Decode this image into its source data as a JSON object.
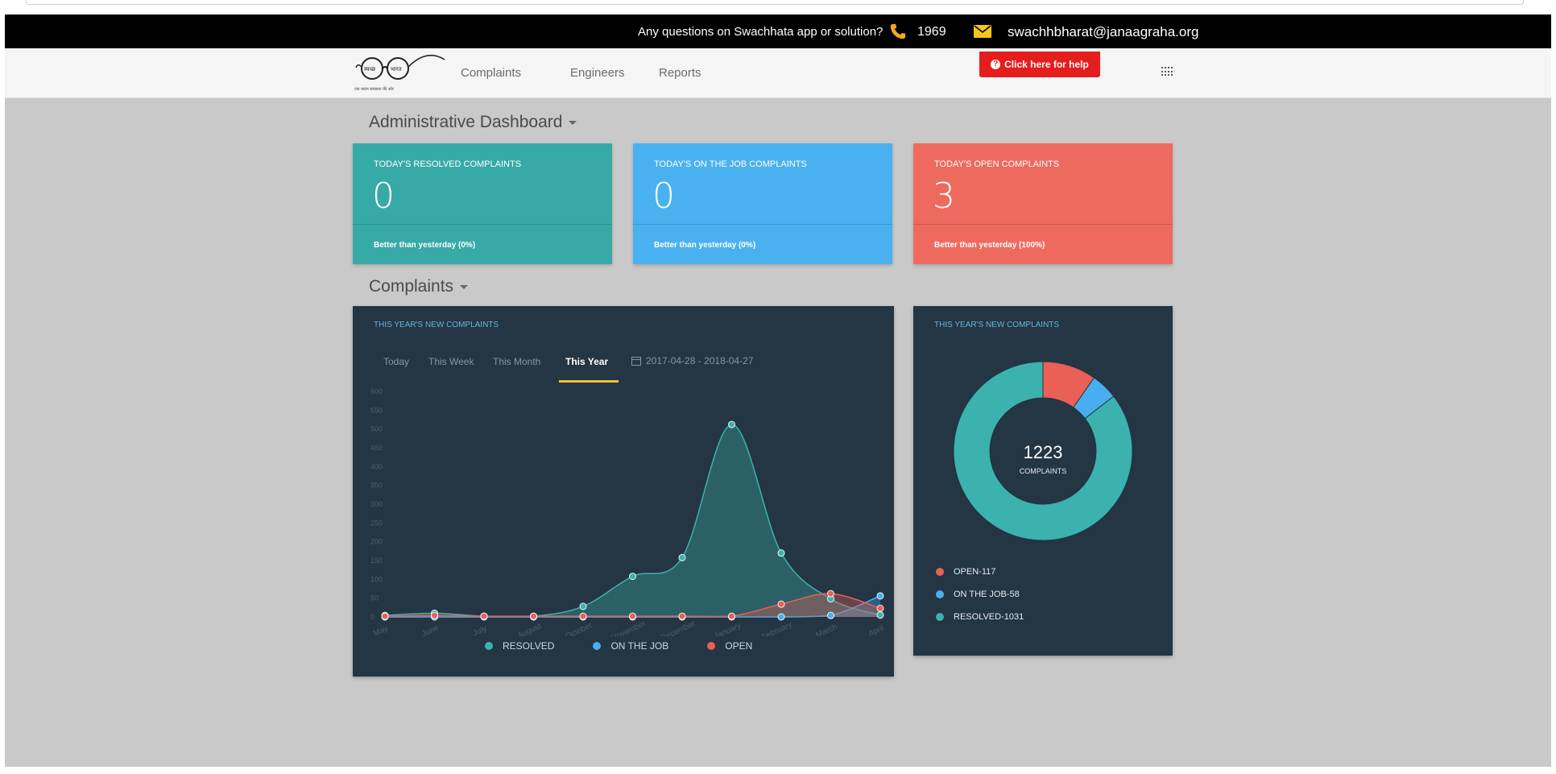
{
  "topbar": {
    "question": "Any questions on Swachhata app or solution?",
    "phone": "1969",
    "email": "swachhbharat@janaagraha.org"
  },
  "navbar": {
    "links": [
      "Complaints",
      "Engineers",
      "Reports"
    ],
    "help_label": "Click here for help",
    "logo_text": "एक कदम स्वच्छता की ओर"
  },
  "dashboard": {
    "title": "Administrative Dashboard",
    "cards": [
      {
        "label": "TODAY'S RESOLVED COMPLAINTS",
        "value": "0",
        "foot": "Better than yesterday (0%)",
        "color": "#37aaa8"
      },
      {
        "label": "TODAY'S ON THE JOB COMPLAINTS",
        "value": "0",
        "foot": "Better than yesterday (0%)",
        "color": "#4ab1f0"
      },
      {
        "label": "TODAY'S OPEN COMPLAINTS",
        "value": "3",
        "foot": "Better than yesterday (100%)",
        "color": "#ee6a5f"
      }
    ]
  },
  "complaints": {
    "title": "Complaints",
    "line_panel": {
      "title": "THIS YEAR'S NEW COMPLAINTS",
      "tabs": [
        "Today",
        "This Week",
        "This Month",
        "This Year"
      ],
      "active_tab": "This Year",
      "date_range": "2017-04-28 - 2018-04-27",
      "legend": [
        "RESOLVED",
        "ON THE JOB",
        "OPEN"
      ]
    },
    "donut_panel": {
      "title": "THIS YEAR'S NEW COMPLAINTS",
      "total": "1223",
      "total_label": "COMPLAINTS",
      "legend": [
        "OPEN-117",
        "ON THE JOB-58",
        "RESOLVED-1031"
      ]
    }
  },
  "colors": {
    "resolved": "#3bb2ad",
    "on_the_job": "#48aef0",
    "open": "#ea5f56"
  },
  "chart_data": [
    {
      "type": "area",
      "categories": [
        "May",
        "June",
        "July",
        "August",
        "October",
        "November",
        "December",
        "January",
        "February",
        "March",
        "April"
      ],
      "ylim": [
        0,
        600
      ],
      "yticks": [
        "0",
        "50",
        "100",
        "150",
        "200",
        "250",
        "300",
        "350",
        "400",
        "450",
        "500",
        "550",
        "600"
      ],
      "series": [
        {
          "name": "RESOLVED",
          "values": [
            4,
            10,
            2,
            2,
            28,
            108,
            158,
            512,
            170,
            48,
            5
          ]
        },
        {
          "name": "ON THE JOB",
          "values": [
            0,
            0,
            0,
            0,
            0,
            0,
            0,
            0,
            0,
            4,
            56
          ]
        },
        {
          "name": "OPEN",
          "values": [
            2,
            4,
            2,
            2,
            2,
            2,
            2,
            2,
            34,
            62,
            23
          ]
        }
      ]
    },
    {
      "type": "pie",
      "categories": [
        "OPEN",
        "ON THE JOB",
        "RESOLVED"
      ],
      "values": [
        117,
        58,
        1031
      ],
      "total": 1223
    }
  ]
}
